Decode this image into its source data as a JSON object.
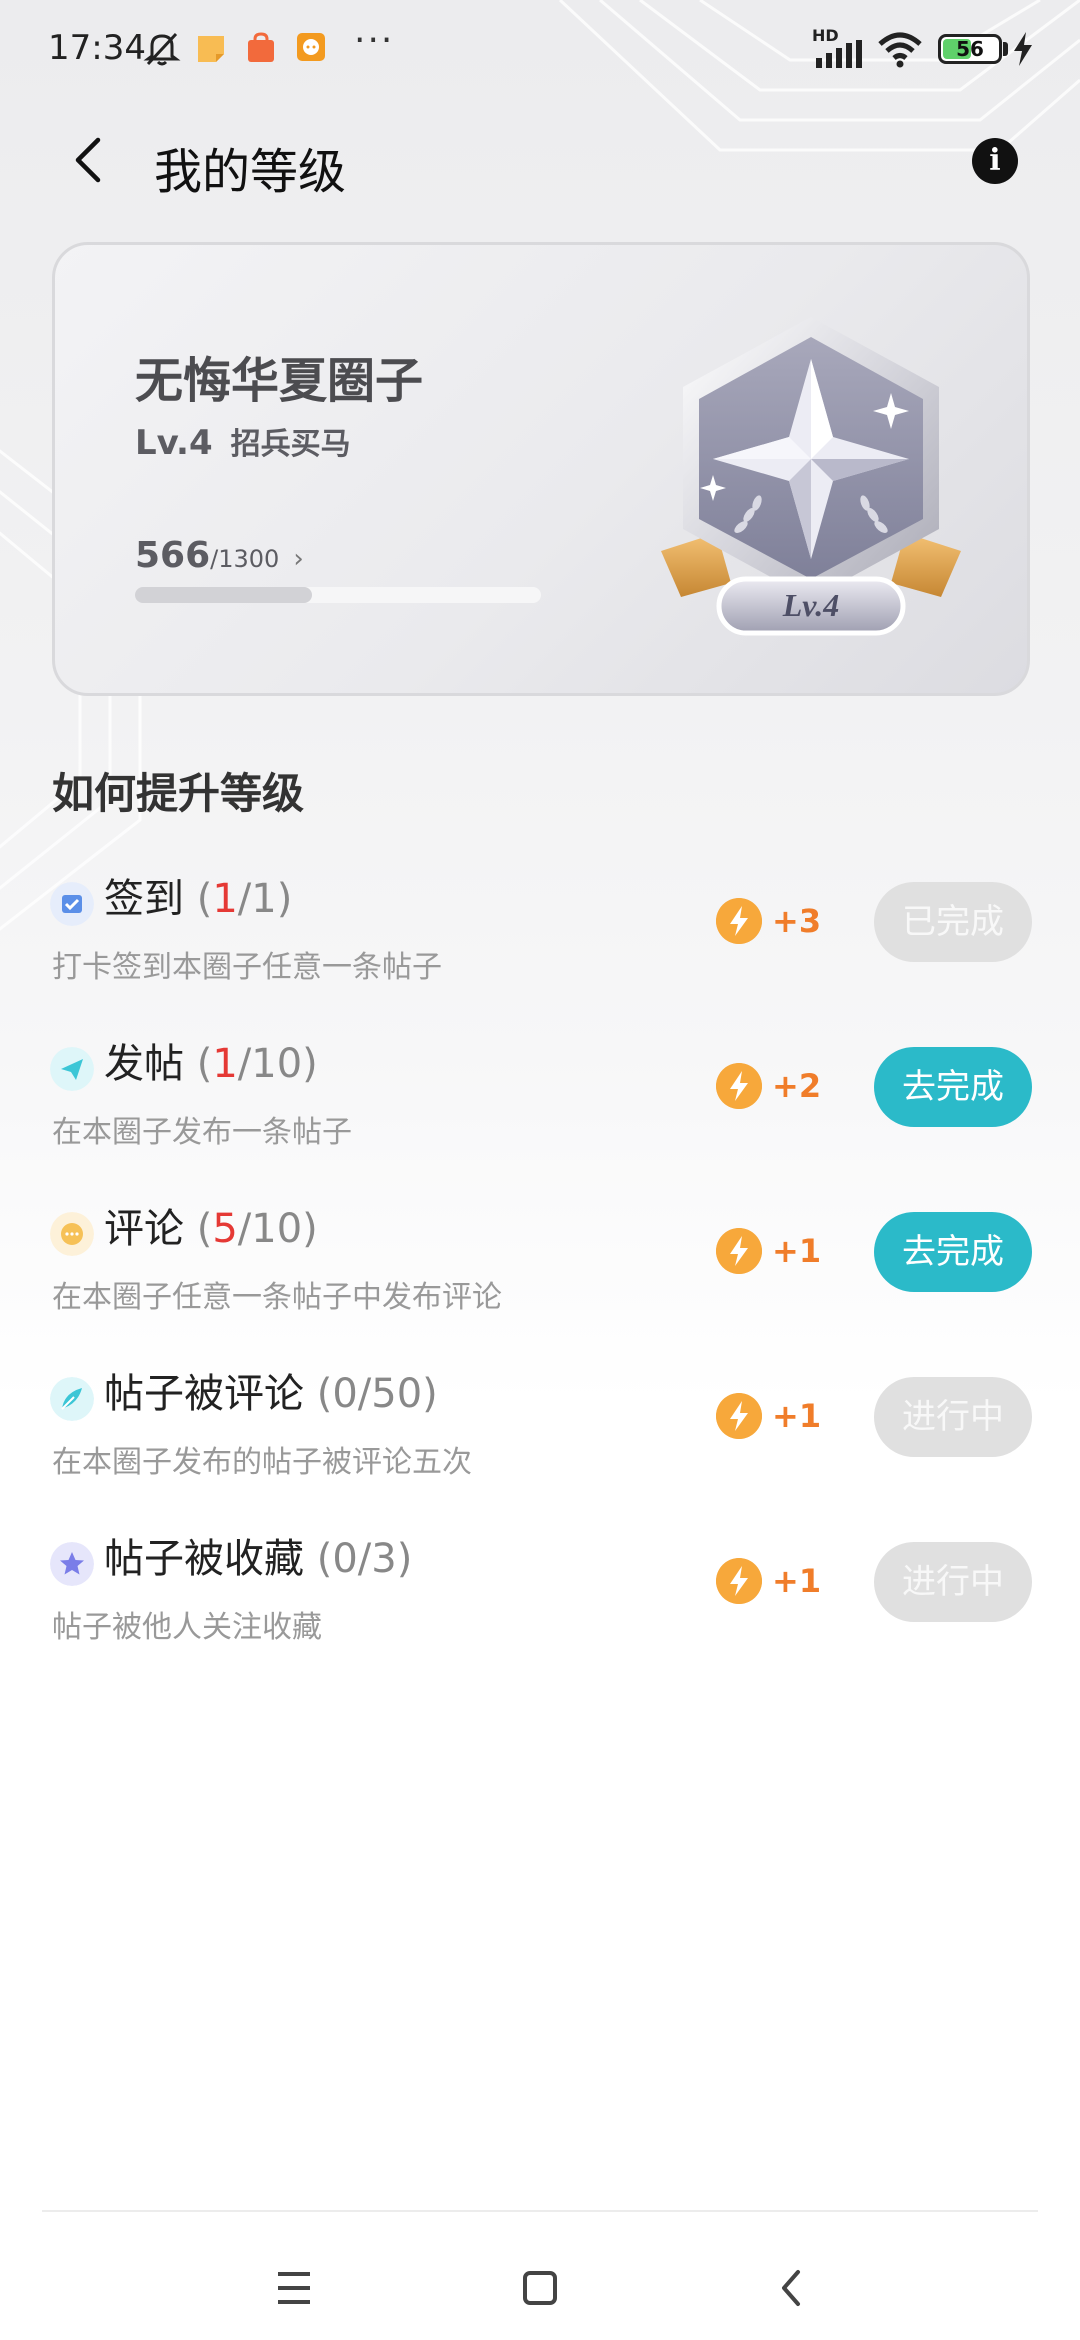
{
  "status_bar": {
    "time": "17:34",
    "network": "HD",
    "battery_percent": "56",
    "battery_level": 0.56,
    "icons": [
      "bell-muted-icon",
      "sticky-note-icon",
      "shopping-bag-icon",
      "chat-app-icon",
      "more-dots-icon",
      "signal-icon",
      "wifi-icon",
      "battery-icon",
      "charging-icon"
    ],
    "more": "···"
  },
  "header": {
    "title": "我的等级",
    "info_glyph": "i"
  },
  "level_card": {
    "circle_name": "无悔华夏圈子",
    "level": "Lv.4",
    "level_name": "招兵买马",
    "progress_current": "566",
    "progress_total": "/1300",
    "progress_chevron": "›",
    "progress_fraction": 0.435,
    "badge_label": "Lv.4"
  },
  "section": {
    "title": "如何提升等级"
  },
  "tasks": [
    {
      "title": "签到",
      "open": " (",
      "done": "1",
      "total": "/1)",
      "desc": "打卡签到本圈子任意一条帖子",
      "points": "+3",
      "button": "已完成",
      "button_style": "grey",
      "icon": "calendar-check-icon",
      "icon_color": "#5b8fe8"
    },
    {
      "title": "发帖",
      "open": " (",
      "done": "1",
      "total": "/10)",
      "desc": "在本圈子发布一条帖子",
      "points": "+2",
      "button": "去完成",
      "button_style": "teal",
      "icon": "paper-plane-icon",
      "icon_color": "#3cc6d6"
    },
    {
      "title": "评论",
      "open": " (",
      "done": "5",
      "total": "/10)",
      "desc": "在本圈子任意一条帖子中发布评论",
      "points": "+1",
      "button": "去完成",
      "button_style": "teal",
      "icon": "comment-bubble-icon",
      "icon_color": "#f6c157"
    },
    {
      "title": "帖子被评论",
      "open": " (",
      "done": "0",
      "total": "/50)",
      "desc": "在本圈子发布的帖子被评论五次",
      "points": "+1",
      "button": "进行中",
      "button_style": "grey",
      "icon": "feather-icon",
      "icon_color": "#3cc6d6"
    },
    {
      "title": "帖子被收藏",
      "open": " (",
      "done": "0",
      "total": "/3)",
      "desc": "帖子被他人关注收藏",
      "points": "+1",
      "button": "进行中",
      "button_style": "grey",
      "icon": "star-icon",
      "icon_color": "#7a7de8"
    }
  ],
  "colors": {
    "accent_teal": "#2bbac9",
    "points_orange": "#f07d2a",
    "bolt_orange": "#f7a83b",
    "highlight_red": "#e53935",
    "disabled_grey": "#e0e0e0"
  },
  "nav_bar": {
    "items": [
      "menu-icon",
      "home-square-icon",
      "back-triangle-icon"
    ]
  }
}
